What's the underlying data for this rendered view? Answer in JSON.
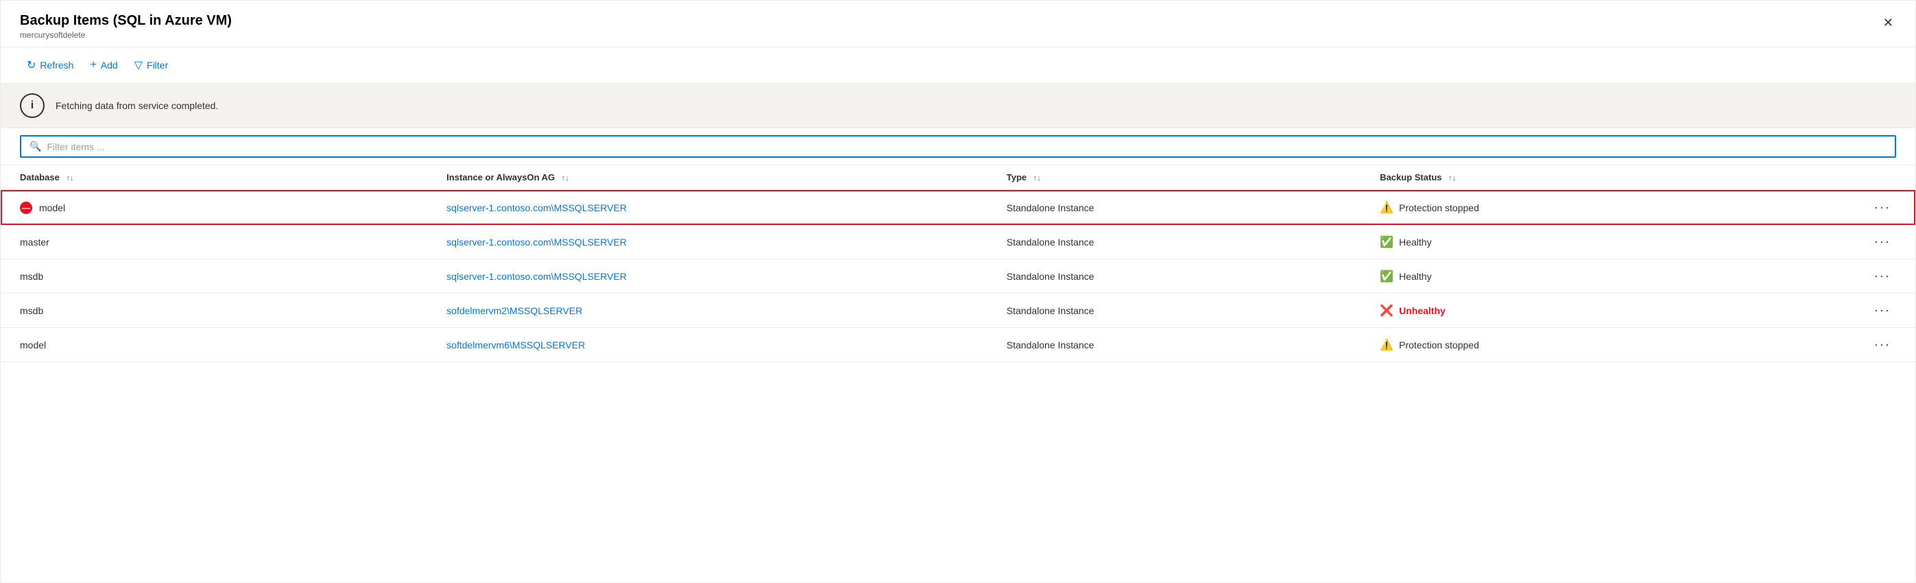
{
  "panel": {
    "title": "Backup Items (SQL in Azure VM)",
    "subtitle": "mercurysoftdelete",
    "close_label": "✕"
  },
  "toolbar": {
    "refresh_label": "Refresh",
    "add_label": "Add",
    "filter_label": "Filter"
  },
  "banner": {
    "message": "Fetching data from service completed."
  },
  "filter": {
    "placeholder": "Filter items ..."
  },
  "table": {
    "columns": [
      {
        "id": "database",
        "label": "Database",
        "sortable": true
      },
      {
        "id": "instance",
        "label": "Instance or AlwaysOn AG",
        "sortable": true
      },
      {
        "id": "type",
        "label": "Type",
        "sortable": true
      },
      {
        "id": "status",
        "label": "Backup Status",
        "sortable": true
      },
      {
        "id": "actions",
        "label": "",
        "sortable": false
      }
    ],
    "rows": [
      {
        "id": 1,
        "selected": true,
        "database": "model",
        "instance": "sqlserver-1.contoso.com\\MSSQLSERVER",
        "type": "Standalone Instance",
        "status_type": "protection_stopped",
        "status_label": "Protection stopped"
      },
      {
        "id": 2,
        "selected": false,
        "database": "master",
        "instance": "sqlserver-1.contoso.com\\MSSQLSERVER",
        "type": "Standalone Instance",
        "status_type": "healthy",
        "status_label": "Healthy"
      },
      {
        "id": 3,
        "selected": false,
        "database": "msdb",
        "instance": "sqlserver-1.contoso.com\\MSSQLSERVER",
        "type": "Standalone Instance",
        "status_type": "healthy",
        "status_label": "Healthy"
      },
      {
        "id": 4,
        "selected": false,
        "database": "msdb",
        "instance": "sofdelmervm2\\MSSQLSERVER",
        "type": "Standalone Instance",
        "status_type": "unhealthy",
        "status_label": "Unhealthy"
      },
      {
        "id": 5,
        "selected": false,
        "database": "model",
        "instance": "softdelmervm6\\MSSQLSERVER",
        "type": "Standalone Instance",
        "status_type": "protection_stopped",
        "status_label": "Protection stopped"
      }
    ]
  },
  "colors": {
    "accent": "#0078d4",
    "error": "#e81123",
    "warning": "#d83b01",
    "healthy": "#107c10",
    "border_selected": "#e81123"
  }
}
